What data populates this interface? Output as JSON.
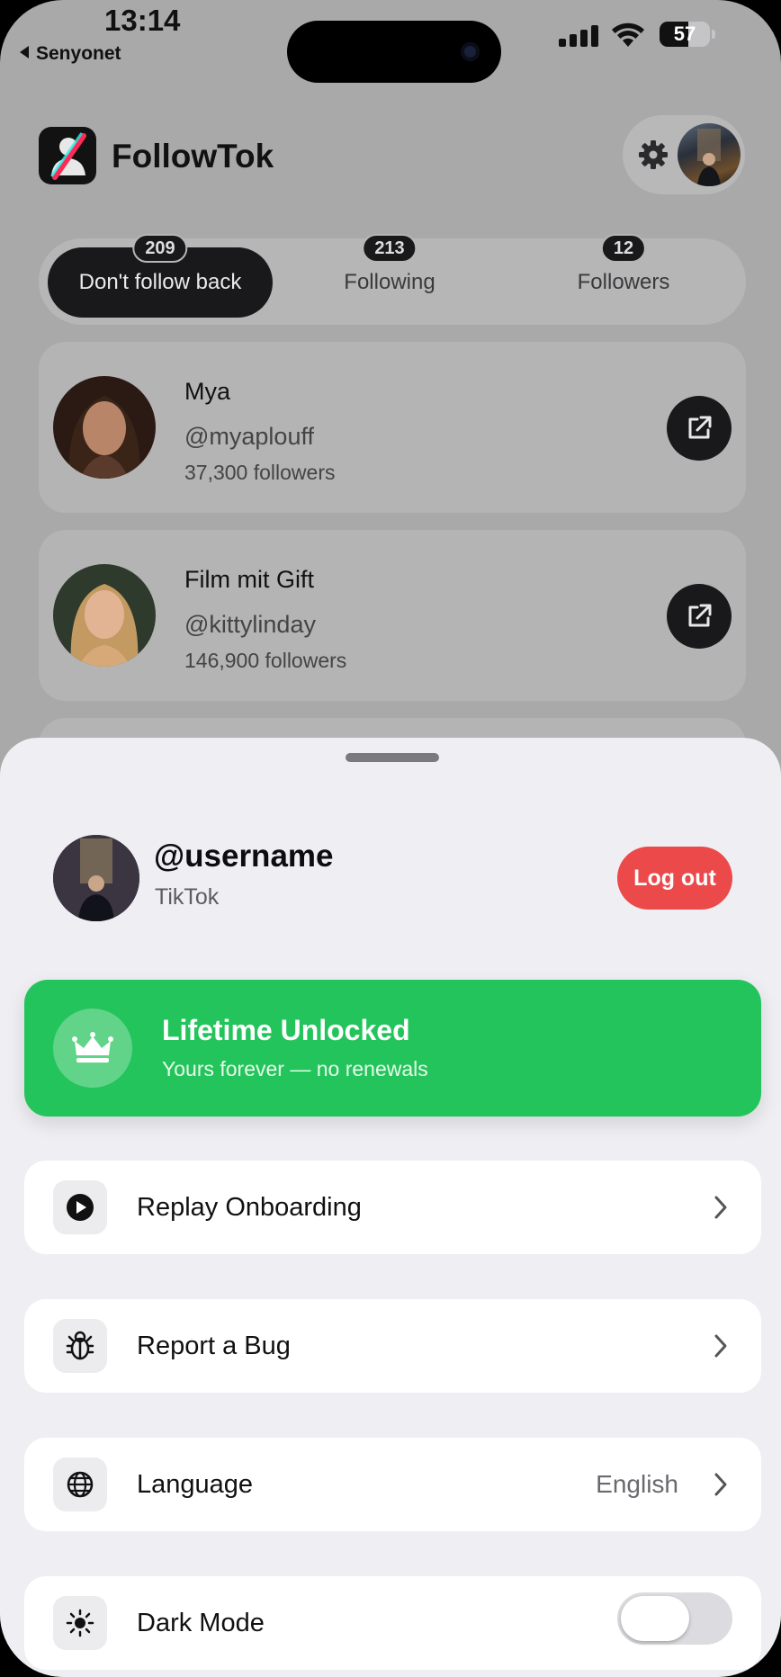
{
  "status_bar": {
    "time": "13:14",
    "back_label": "Senyonet",
    "battery": "57",
    "battery_level": 0.57
  },
  "header": {
    "app_name": "FollowTok",
    "settings_icon": "gear-icon"
  },
  "tabs": [
    {
      "label": "Don't follow back",
      "count": "209",
      "active": true
    },
    {
      "label": "Following",
      "count": "213",
      "active": false
    },
    {
      "label": "Followers",
      "count": "12",
      "active": false
    }
  ],
  "users": [
    {
      "name": "Mya",
      "handle": "@myaplouff",
      "followers": "37,300 followers"
    },
    {
      "name": "Film mit Gift",
      "handle": "@kittylinday",
      "followers": "146,900 followers"
    }
  ],
  "sheet": {
    "username": "@username",
    "platform": "TikTok",
    "logout_label": "Log out",
    "unlock": {
      "title": "Lifetime Unlocked",
      "subtitle": "Yours forever — no renewals",
      "icon": "crown-icon"
    },
    "rows": [
      {
        "label": "Replay Onboarding",
        "icon": "play-icon"
      },
      {
        "label": "Report a Bug",
        "icon": "bug-icon"
      },
      {
        "label": "Language",
        "value": "English",
        "icon": "globe-icon"
      },
      {
        "label": "Dark Mode",
        "icon": "sun-icon",
        "toggle_on": false
      }
    ]
  },
  "colors": {
    "accent_green": "#24c45c",
    "logout_red": "#ec4a4a",
    "dark": "#19191b"
  }
}
